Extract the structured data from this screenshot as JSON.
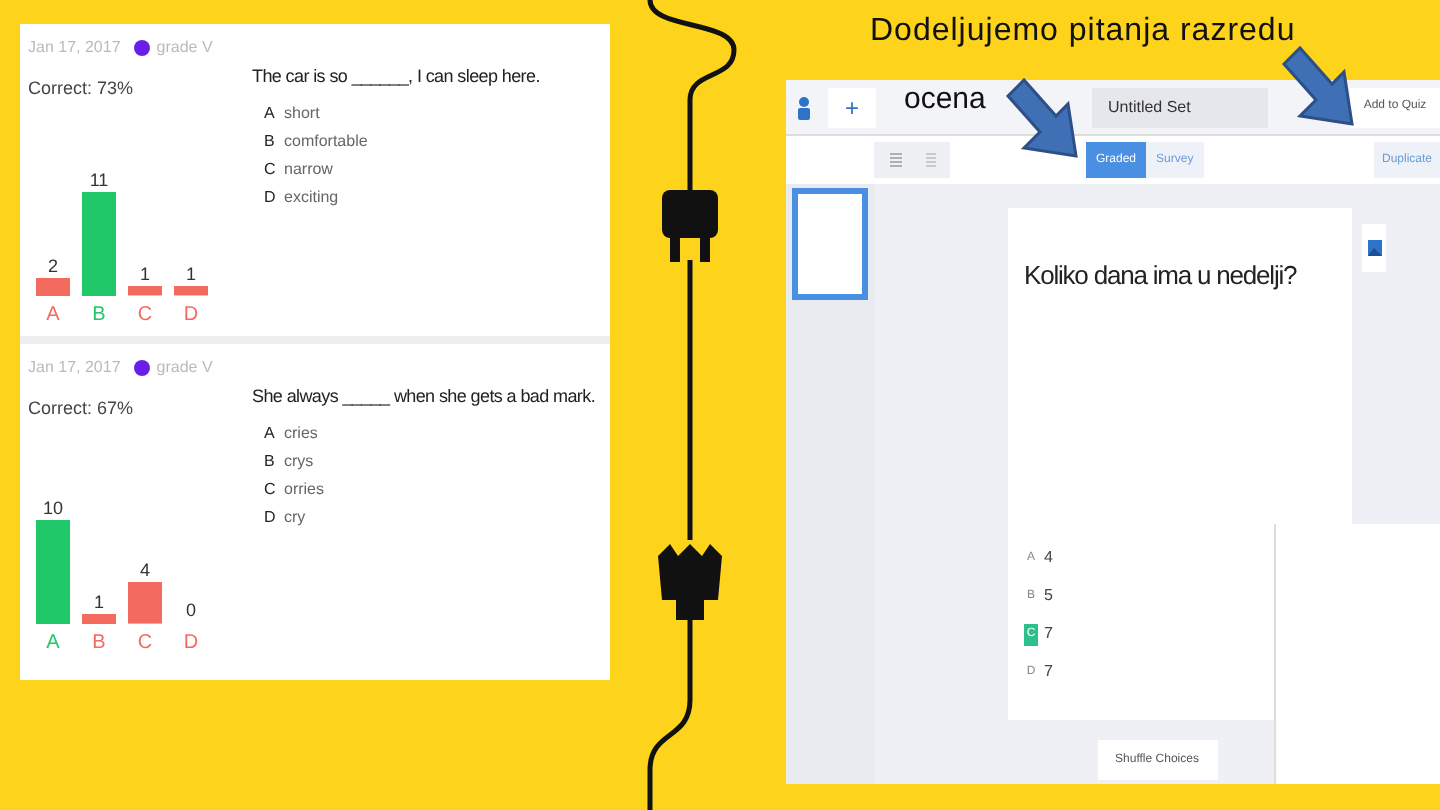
{
  "slide": {
    "title": "Dodeljujemo pitanja razredu",
    "caption": "ocena"
  },
  "report": {
    "questions": [
      {
        "date": "Jan 17, 2017",
        "class_name": "grade V",
        "correct": "Correct: 73%",
        "question": "The car is so ______, I can sleep here.",
        "options": [
          {
            "letter": "A",
            "text": "short"
          },
          {
            "letter": "B",
            "text": "comfortable"
          },
          {
            "letter": "C",
            "text": "narrow"
          },
          {
            "letter": "D",
            "text": "exciting"
          }
        ],
        "chart_data": {
          "type": "bar",
          "categories": [
            "A",
            "B",
            "C",
            "D"
          ],
          "data_labels": true,
          "series": [
            {
              "color": "#20c86a",
              "values": [
                null,
                11,
                null,
                null
              ]
            },
            {
              "color": "#f26b5e",
              "values": [
                2,
                null,
                1,
                1
              ]
            }
          ]
        }
      },
      {
        "date": "Jan 17, 2017",
        "class_name": "grade V",
        "correct": "Correct: 67%",
        "question": "She always _____ when she gets a bad mark.",
        "options": [
          {
            "letter": "A",
            "text": "cries"
          },
          {
            "letter": "B",
            "text": "crys"
          },
          {
            "letter": "C",
            "text": "orries"
          },
          {
            "letter": "D",
            "text": "cry"
          }
        ],
        "chart_data": {
          "type": "bar",
          "categories": [
            "A",
            "B",
            "C",
            "D"
          ],
          "data_labels": true,
          "series": [
            {
              "color": "#20c86a",
              "values": [
                10,
                null,
                null,
                null
              ]
            },
            {
              "color": "#f26b5e",
              "values": [
                null,
                1,
                4,
                0
              ]
            }
          ]
        }
      }
    ]
  },
  "editor": {
    "set_title": "Untitled Set",
    "add_button": "+",
    "add_to_quiz": "Add to Quiz",
    "modes": [
      {
        "label": "Graded",
        "selected": true
      },
      {
        "label": "Survey",
        "selected": false
      }
    ],
    "duplicate": "Duplicate",
    "question": "Koliko dana ima u nedelji?",
    "choices": [
      {
        "letter": "A",
        "text": "4",
        "correct": false
      },
      {
        "letter": "B",
        "text": "5",
        "correct": false
      },
      {
        "letter": "C",
        "text": "7",
        "correct": true
      },
      {
        "letter": "D",
        "text": "7",
        "correct": false
      }
    ],
    "shuffle": "Shuffle Choices"
  }
}
